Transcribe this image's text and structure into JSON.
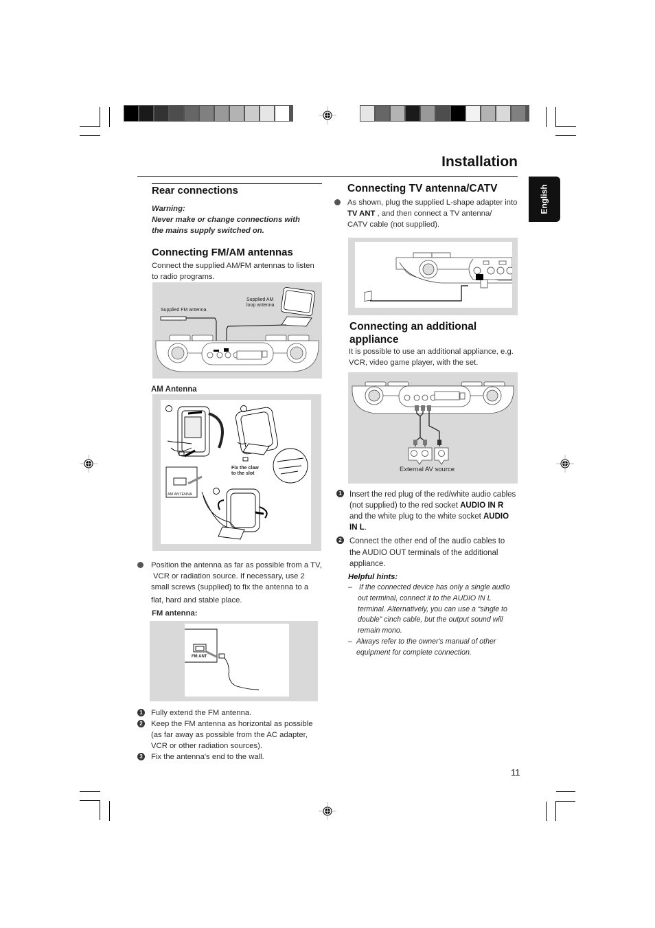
{
  "page": {
    "title": "Installation",
    "language_tab": "English",
    "page_number": "11"
  },
  "calibration": {
    "left_bar_grays": [
      "#000000",
      "#1a1a1a",
      "#333333",
      "#4d4d4d",
      "#666666",
      "#808080",
      "#999999",
      "#b3b3b3",
      "#cccccc",
      "#e6e6e6",
      "#ffffff"
    ],
    "right_bar_grays": [
      "#e6e6e6",
      "#666666",
      "#b3b3b3",
      "#1a1a1a",
      "#999999",
      "#4d4d4d",
      "#000000",
      "#f2f2f2",
      "#b3b3b3",
      "#d9d9d9",
      "#808080"
    ]
  },
  "left": {
    "rear": {
      "heading": "Rear connections",
      "warning_label": "Warning:",
      "warning_text_1": "Never make or change connections with",
      "warning_text_2": "the mains supply switched on."
    },
    "fmam": {
      "heading": "Connecting FM/AM antennas",
      "intro_1": "Connect the supplied AM/FM antennas to listen",
      "intro_2": "to radio programs.",
      "fig_label_fm": "Supplied FM antenna",
      "fig_label_am_1": "Supplied AM",
      "fig_label_am_2": "loop antenna"
    },
    "am": {
      "heading": "AM Antenna",
      "step_labels": [
        "1",
        "2",
        "3"
      ],
      "claw_note_1": "Fix the claw",
      "claw_note_2": "to the slot",
      "socket_label": "AM ANTENNA",
      "bullet_lines": [
        "Position the antenna as far as possible from a TV,",
        "VCR or radiation source. If necessary, use 2",
        "small screws (supplied) to fix the antenna to a",
        "flat, hard and stable place."
      ]
    },
    "fm": {
      "heading": "FM antenna:",
      "socket_label": "FM ANT",
      "steps": [
        {
          "num": "1",
          "lines": [
            "Fully extend the FM antenna."
          ]
        },
        {
          "num": "2",
          "lines": [
            "Keep the FM antenna as horizontal as possible",
            "(as far away as possible from the AC adapter,",
            "VCR or other radiation sources)."
          ]
        },
        {
          "num": "3",
          "lines": [
            "Fix the antenna's end to the wall."
          ]
        }
      ]
    }
  },
  "right": {
    "tv": {
      "heading": "Connecting TV antenna/CATV",
      "line_1": "As shown, plug the supplied L-shape adapter into",
      "line_2_bold": "TV ANT",
      "line_2_rest": " , and then connect a TV antenna/",
      "line_3": "CATV cable (not supplied)."
    },
    "appliance": {
      "heading_1": "Connecting an additional",
      "heading_2": "appliance",
      "intro_1": "It is possible to use an additional appliance, e.g.",
      "intro_2": "VCR, video game player, with the set.",
      "fig_caption": "External AV source",
      "step1": {
        "num": "1",
        "l1": "Insert the red plug of the red/white audio cables",
        "l2a": "(not supplied) to the red socket ",
        "l2b": "AUDIO IN R",
        "l3a": "and the white plug to the white socket ",
        "l3b": "AUDIO",
        "l4b": "IN L",
        "l4c": "."
      },
      "step2": {
        "num": "2",
        "lines": [
          "Connect the other end of the audio cables to",
          "the AUDIO OUT terminals of the additional",
          "appliance."
        ]
      },
      "hints_heading": "Helpful hints:",
      "hints": [
        {
          "dash": "–",
          "lines": [
            "If the connected device has only a single audio",
            "out terminal, connect it to the AUDIO IN L",
            "terminal. Alternatively, you can use a “single to",
            "double” cinch cable, but the output sound will",
            "remain mono."
          ]
        },
        {
          "dash": "–",
          "lines": [
            "Always refer to the owner's manual of other",
            "equipment for complete connection."
          ]
        }
      ]
    }
  }
}
